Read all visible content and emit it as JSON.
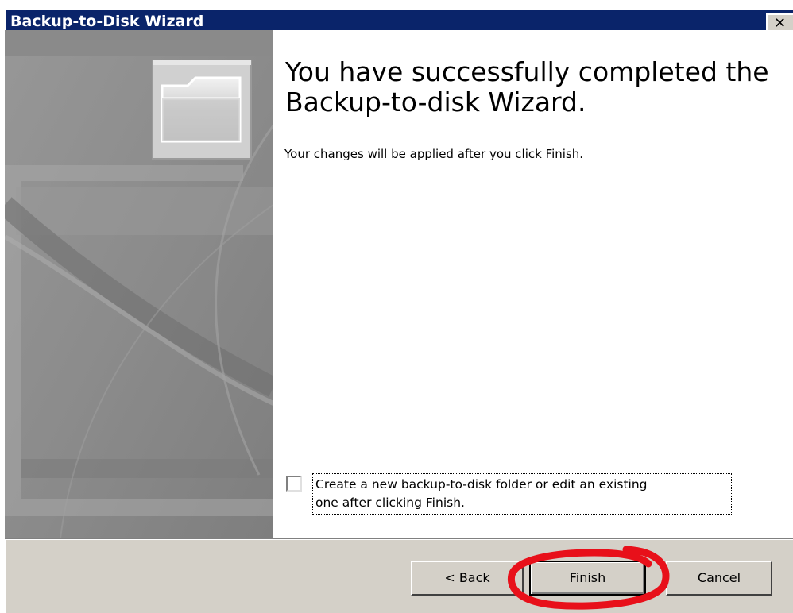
{
  "window": {
    "title": "Backup-to-Disk Wizard",
    "close_glyph": "✕"
  },
  "content": {
    "heading": "You have successfully completed the Backup-to-disk Wizard.",
    "subtext": "Your changes will be applied after you click Finish."
  },
  "option": {
    "checked": false,
    "label_line1": "Create a new backup-to-disk folder or edit an existing",
    "label_line2": "one after clicking Finish."
  },
  "buttons": {
    "back": "< Back",
    "finish": "Finish",
    "cancel": "Cancel"
  },
  "colors": {
    "titlebar": "#0a246a",
    "dialog_face": "#d4d0c8",
    "banner": "#8e8e8e",
    "highlight_annotation": "#e8101a"
  },
  "icons": {
    "banner_image": "folder-icon"
  }
}
